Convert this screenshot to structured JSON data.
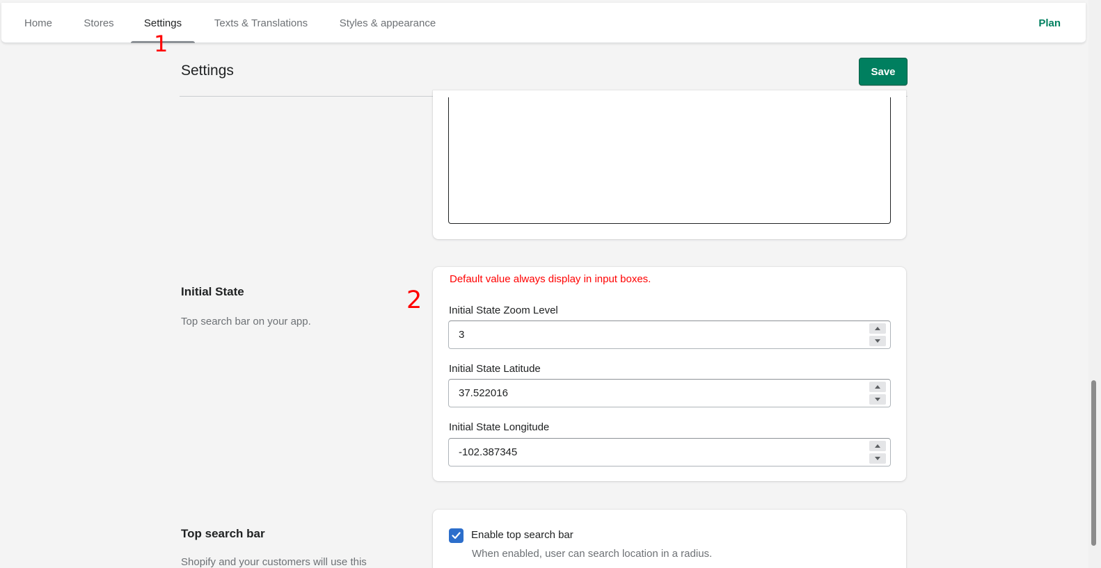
{
  "nav": {
    "tabs": [
      {
        "label": "Home"
      },
      {
        "label": "Stores"
      },
      {
        "label": "Settings"
      },
      {
        "label": "Texts & Translations"
      },
      {
        "label": "Styles & appearance"
      }
    ],
    "active_tab": "Settings",
    "plan_label": "Plan"
  },
  "annotations": {
    "marker_1": "1",
    "marker_2": "2",
    "color": "#ff0000"
  },
  "page": {
    "title": "Settings",
    "save_label": "Save"
  },
  "initial_state": {
    "title": "Initial State",
    "description": "Top search bar on your app.",
    "warning": "Default value always display in input boxes.",
    "fields": [
      {
        "label": "Initial State Zoom Level",
        "value": "3"
      },
      {
        "label": "Initial State Latitude",
        "value": "37.522016"
      },
      {
        "label": "Initial State Longitude",
        "value": "-102.387345"
      }
    ]
  },
  "top_search_bar": {
    "title": "Top search bar",
    "description": "Shopify and your customers will use this",
    "checkbox_label": "Enable top search bar",
    "checked": true,
    "help_text": "When enabled, user can search location in a radius."
  },
  "colors": {
    "primary": "#008060",
    "save_button": "#007f5f",
    "checkbox": "#2c6ecb",
    "warning": "#ff0000"
  },
  "icons": {
    "spin_up": "caret-up-icon",
    "spin_down": "caret-down-icon",
    "check": "checkmark-icon"
  }
}
